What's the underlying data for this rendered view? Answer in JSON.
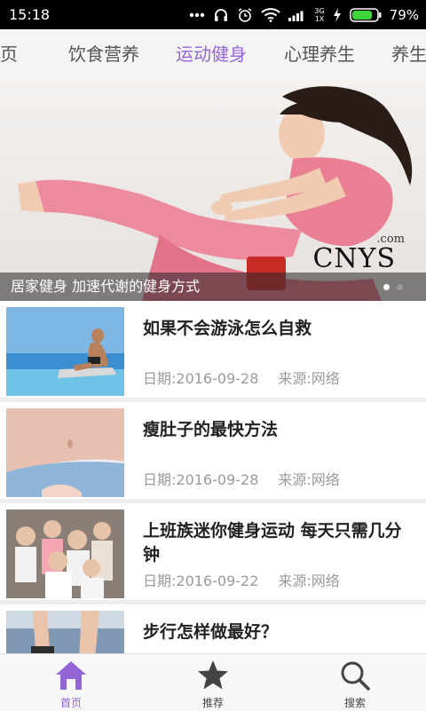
{
  "status_bar": {
    "time": "15:18",
    "network_top": "3G",
    "network_bottom": "1X",
    "battery_percent": "79%"
  },
  "tabs": [
    {
      "label": "页"
    },
    {
      "label": "饮食营养"
    },
    {
      "label": "运动健身"
    },
    {
      "label": "心理养生"
    },
    {
      "label": "养生"
    }
  ],
  "active_tab": "运动健身",
  "banner": {
    "caption": "居家健身 加速代谢的健身方式",
    "watermark": "CNYS",
    "watermark_suffix": ".com",
    "slide_count": 2,
    "active_slide": 1
  },
  "articles": [
    {
      "title": "如果不会游泳怎么自救",
      "date": "日期:2016-09-28",
      "source": "来源:网络"
    },
    {
      "title": "瘦肚子的最快方法",
      "date": "日期:2016-09-28",
      "source": "来源:网络"
    },
    {
      "title": "上班族迷你健身运动 每天只需几分钟",
      "date": "日期:2016-09-22",
      "source": "来源:网络"
    },
    {
      "title": "步行怎样做最好？",
      "date": "",
      "source": ""
    }
  ],
  "bottom_nav": [
    {
      "label": "首页",
      "icon": "home-icon",
      "active": true
    },
    {
      "label": "推荐",
      "icon": "star-icon",
      "active": false
    },
    {
      "label": "搜索",
      "icon": "search-icon",
      "active": false
    }
  ],
  "colors": {
    "accent": "#9366d6",
    "status_bar": "#000000",
    "tab_text": "#555555",
    "meta_text": "#9a9a9a"
  }
}
